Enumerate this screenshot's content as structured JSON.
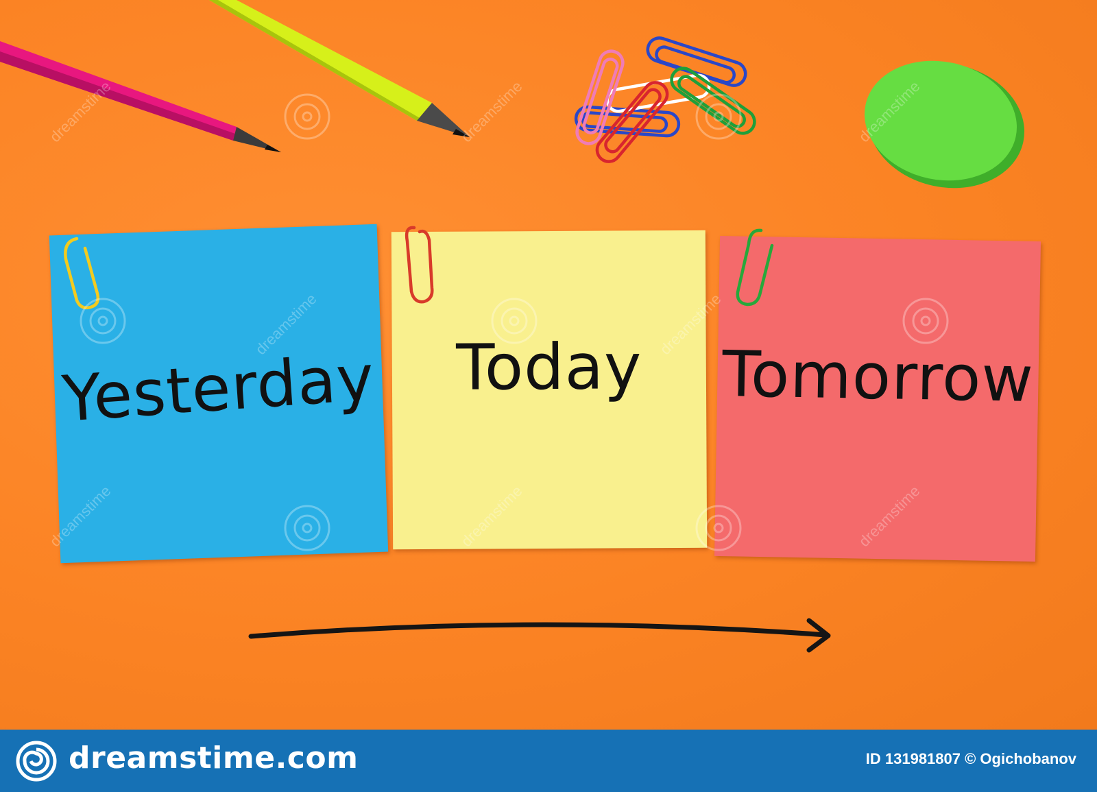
{
  "notes": {
    "yesterday": {
      "label": "Yesterday",
      "color": "#2ab0e6"
    },
    "today": {
      "label": "Today",
      "color": "#f9f08e"
    },
    "tomorrow": {
      "label": "Tomorrow",
      "color": "#f46a6b"
    }
  },
  "watermark": {
    "text": "dreamstime"
  },
  "footer": {
    "brand": "dreamstime.com",
    "credit": "ID 131981807 © Ogichobanov",
    "color": "#1671b5"
  },
  "colors": {
    "background": "#fb8324",
    "pencil_pink": "#e8177f",
    "pencil_yellow": "#d6f01a",
    "eraser": "#5fd63a"
  }
}
